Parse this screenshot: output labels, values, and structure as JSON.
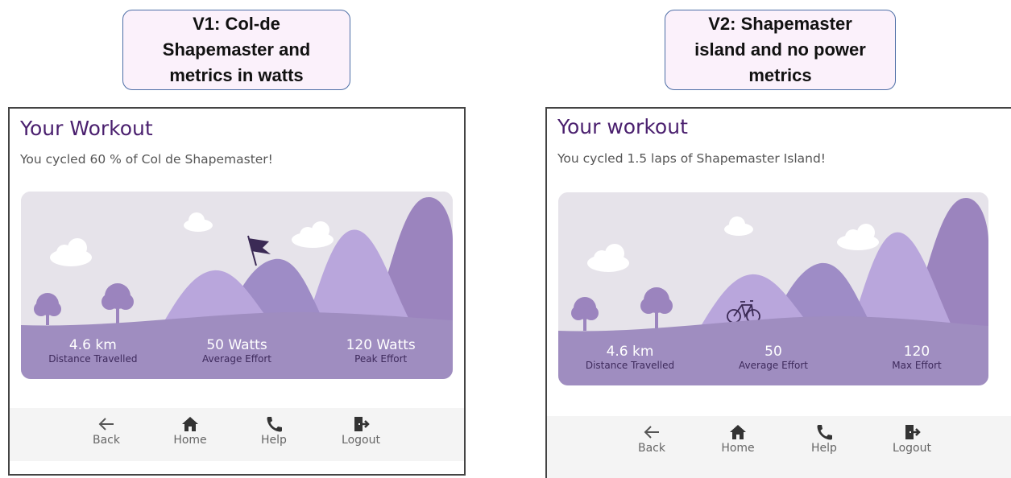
{
  "labels": {
    "v1": {
      "line1": "V1: Col-de",
      "line2": "Shapemaster and",
      "line3": "metrics in watts"
    },
    "v2": {
      "line1": "V2: Shapemaster",
      "line2": "island and no power",
      "line3": "metrics"
    }
  },
  "v1": {
    "title": "Your Workout",
    "subtitle": "You cycled 60 % of Col de Shapemaster!",
    "stats": [
      {
        "value": "4.6 km",
        "label": "Distance Travelled"
      },
      {
        "value": "50 Watts",
        "label": "Average Effort"
      },
      {
        "value": "120 Watts",
        "label": "Peak Effort"
      }
    ],
    "nav": [
      {
        "label": "Back",
        "icon": "back-arrow-icon"
      },
      {
        "label": "Home",
        "icon": "home-icon"
      },
      {
        "label": "Help",
        "icon": "phone-icon"
      },
      {
        "label": "Logout",
        "icon": "logout-icon"
      }
    ]
  },
  "v2": {
    "title": "Your workout",
    "subtitle": "You cycled 1.5 laps of Shapemaster Island!",
    "stats": [
      {
        "value": "4.6 km",
        "label": "Distance Travelled"
      },
      {
        "value": "50",
        "label": "Average Effort"
      },
      {
        "value": "120",
        "label": "Max Effort"
      }
    ],
    "nav": [
      {
        "label": "Back",
        "icon": "back-arrow-icon"
      },
      {
        "label": "Home",
        "icon": "home-icon"
      },
      {
        "label": "Help",
        "icon": "phone-icon"
      },
      {
        "label": "Logout",
        "icon": "logout-icon"
      }
    ]
  },
  "colors": {
    "title": "#4a1f6e",
    "hill_light": "#b9a6dc",
    "hill_mid": "#9e8cc6",
    "hill_dark": "#9b84be",
    "ground": "#9f8dc0",
    "sky": "#e6e3ea"
  }
}
